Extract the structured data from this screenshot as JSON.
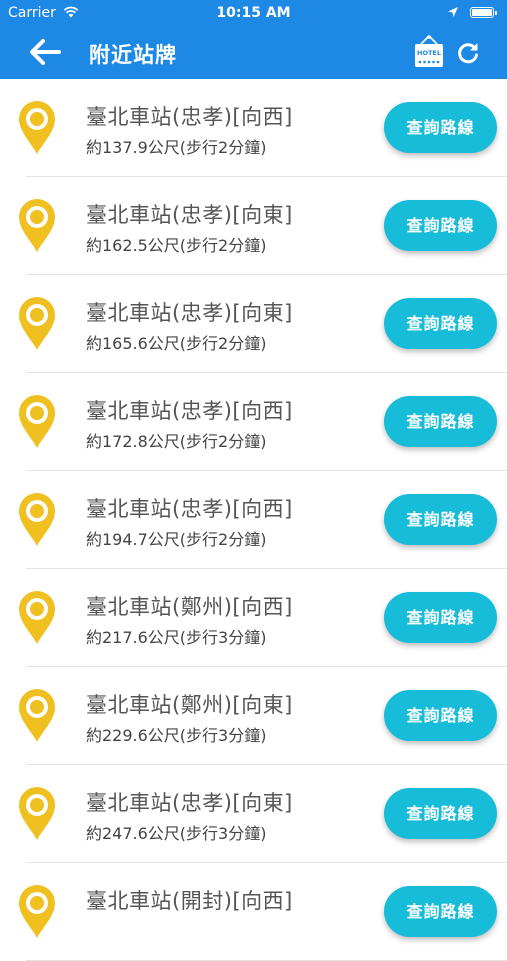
{
  "status_bar": {
    "carrier": "Carrier",
    "time": "10:15 AM"
  },
  "header": {
    "title": "附近站牌",
    "hotel_icon_text": "HOTEL"
  },
  "colors": {
    "header": "#1e88e5",
    "button": "#17bcd9",
    "pin": "#f0c020"
  },
  "stops": [
    {
      "name": "臺北車站(忠孝)[向西]",
      "distance": "約137.9公尺(步行2分鐘)",
      "button": "查詢路線"
    },
    {
      "name": "臺北車站(忠孝)[向東]",
      "distance": "約162.5公尺(步行2分鐘)",
      "button": "查詢路線"
    },
    {
      "name": "臺北車站(忠孝)[向東]",
      "distance": "約165.6公尺(步行2分鐘)",
      "button": "查詢路線"
    },
    {
      "name": "臺北車站(忠孝)[向西]",
      "distance": "約172.8公尺(步行2分鐘)",
      "button": "查詢路線"
    },
    {
      "name": "臺北車站(忠孝)[向西]",
      "distance": "約194.7公尺(步行2分鐘)",
      "button": "查詢路線"
    },
    {
      "name": "臺北車站(鄭州)[向西]",
      "distance": "約217.6公尺(步行3分鐘)",
      "button": "查詢路線"
    },
    {
      "name": "臺北車站(鄭州)[向東]",
      "distance": "約229.6公尺(步行3分鐘)",
      "button": "查詢路線"
    },
    {
      "name": "臺北車站(忠孝)[向東]",
      "distance": "約247.6公尺(步行3分鐘)",
      "button": "查詢路線"
    },
    {
      "name": "臺北車站(開封)[向西]",
      "distance": "",
      "button": "查詢路線"
    }
  ]
}
